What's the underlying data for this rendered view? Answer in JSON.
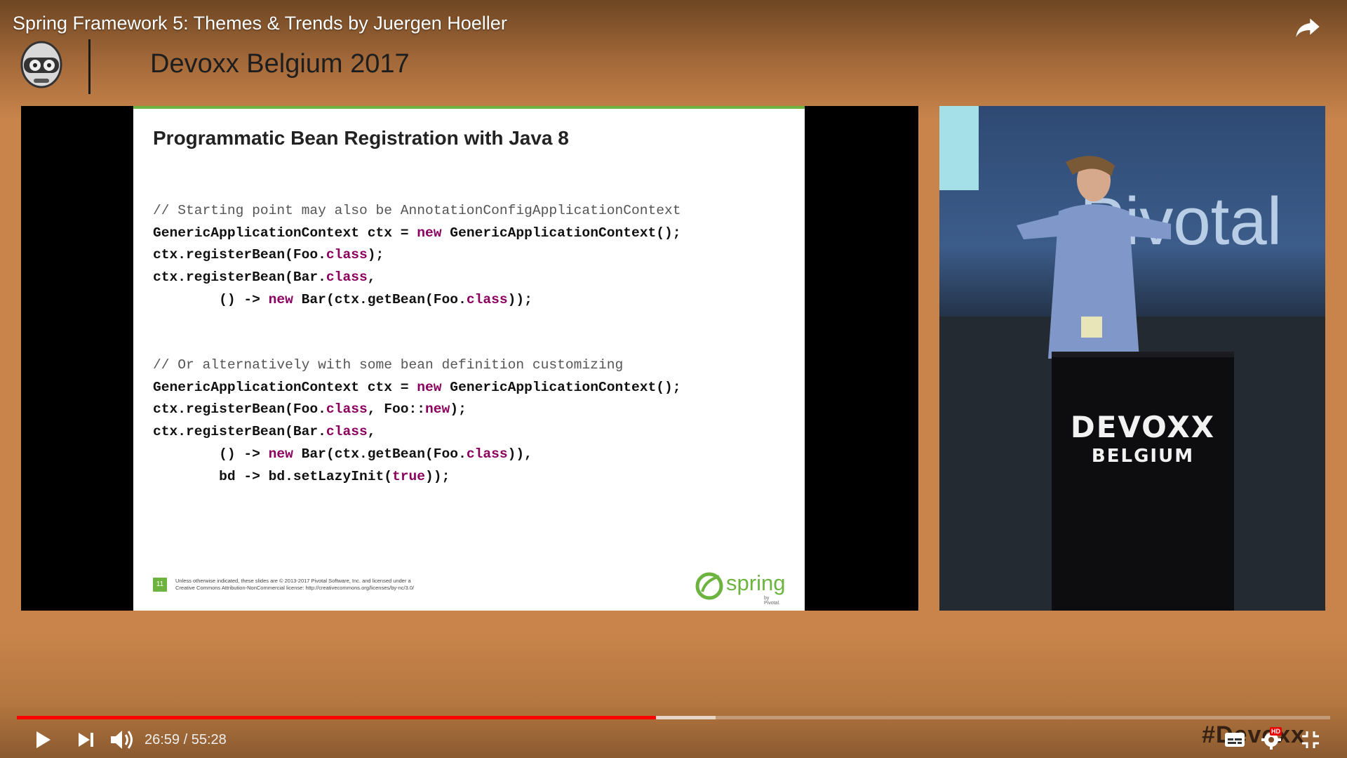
{
  "video": {
    "title": "Spring Framework 5: Themes & Trends by Juergen Hoeller",
    "brand_text": "Devoxx Belgium 2017",
    "hashtag": "#Devoxx"
  },
  "slide": {
    "title": "Programmatic Bean Registration with Java 8",
    "page_number": "11",
    "footer_lines": [
      "Unless otherwise indicated, these slides are © 2013-2017 Pivotal Software, Inc. and licensed under a",
      "Creative Commons Attribution-NonCommercial license: http://creativecommons.org/licenses/by-nc/3.0/"
    ],
    "logo_text": "spring",
    "logo_sub": "by Pivotal.",
    "accent_color": "#6db33f",
    "keyword_color": "#8b005f"
  },
  "camera": {
    "banner_text": "Pivotal",
    "podium_line1": "DEVOXX",
    "podium_line2": "BELGIUM"
  },
  "player": {
    "current_time": "26:59",
    "duration": "55:28",
    "time_display": "26:59 / 55:28",
    "played_fraction": 0.4866,
    "buffered_fraction": 0.5322,
    "progress_color": "#ff0000",
    "hd_badge": "HD"
  },
  "icons": [
    "share-icon",
    "play-icon",
    "next-icon",
    "volume-icon",
    "subtitles-icon",
    "settings-icon",
    "exit-fullscreen-icon"
  ]
}
